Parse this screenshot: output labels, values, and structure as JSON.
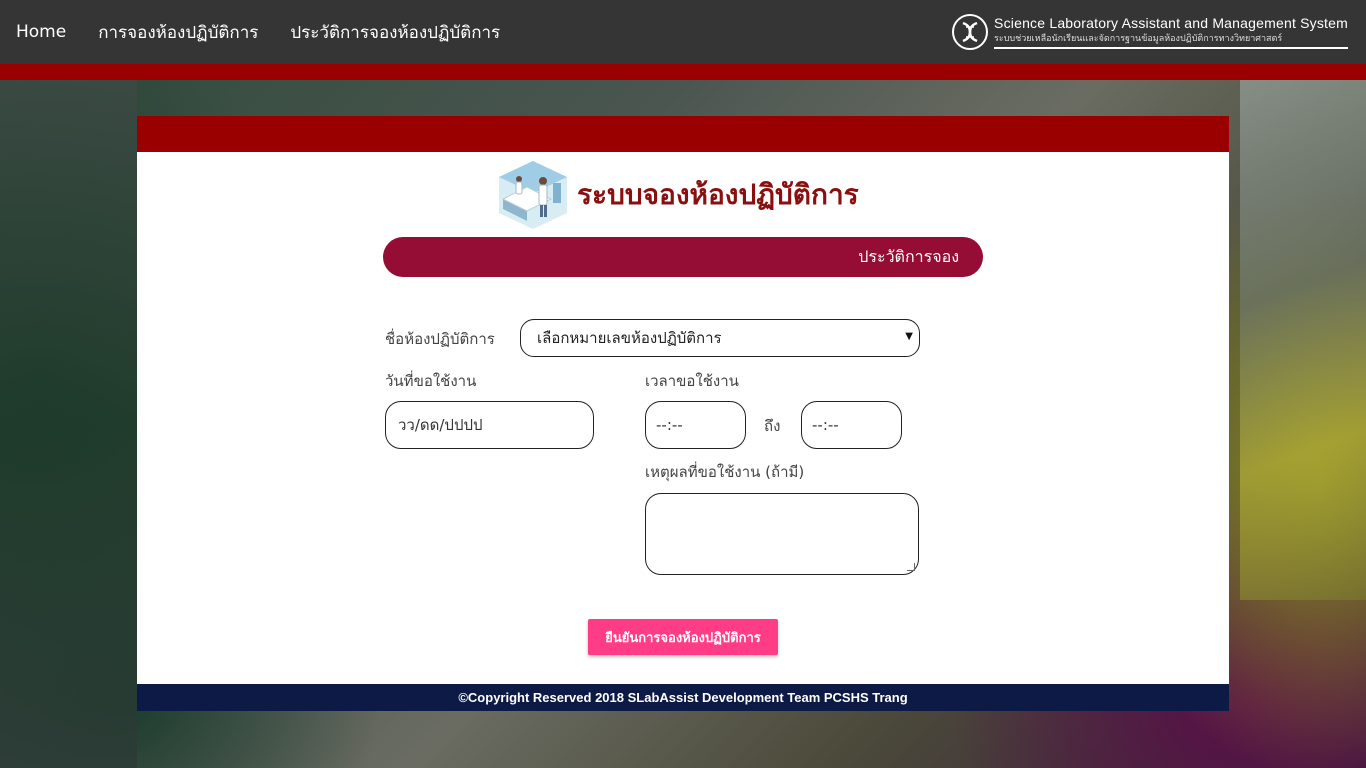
{
  "nav": {
    "items": [
      {
        "label": "Home"
      },
      {
        "label": "การจองห้องปฏิบัติการ"
      },
      {
        "label": "ประวัติการจองห้องปฏิบัติการ"
      }
    ],
    "brand_title": "Science Laboratory Assistant and Management System",
    "brand_subtitle": "ระบบช่วยเหลือนักเรียนและจัดการฐานข้อมูลห้องปฏิบัติการทางวิทยาศาสตร์"
  },
  "panel": {
    "title": "ระบบจองห้องปฏิบัติการ",
    "section_label": "ประวัติการจอง",
    "footer": "©Copyright Reserved 2018 SLabAssist Development Team PCSHS Trang"
  },
  "form": {
    "room_label": "ชื่อห้องปฏิบัติการ",
    "room_placeholder": "เลือกหมายเลขห้องปฏิบัติการ",
    "date_label": "วันที่ขอใช้งาน",
    "date_placeholder": "วว/ดด/ปปปป",
    "time_label": "เวลาขอใช้งาน",
    "time_start_placeholder": "--:--",
    "time_to_label": "ถึง",
    "time_end_placeholder": "--:--",
    "reason_label": "เหตุผลที่ขอใช้งาน (ถ้ามี)",
    "submit_label": "ยืนยันการจองห้องปฏิบัติการ"
  },
  "colors": {
    "navbar": "#353535",
    "accent_red": "#9a0000",
    "section_bar": "#950c35",
    "submit": "#ff3d86",
    "footer": "#0d1a45"
  }
}
